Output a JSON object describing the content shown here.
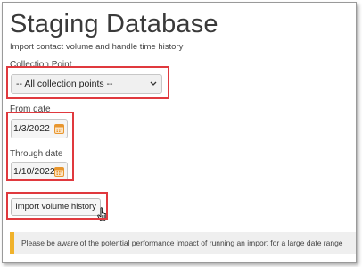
{
  "header": {
    "title": "Staging Database",
    "subtitle": "Import contact volume and handle time history"
  },
  "form": {
    "collection_point_label": "Collection Point",
    "collection_point_value": "-- All collection points --",
    "from_date_label": "From date",
    "from_date_value": "1/3/2022",
    "through_date_label": "Through date",
    "through_date_value": "1/10/2022",
    "import_button_label": "Import volume history"
  },
  "notice": {
    "text": "Please be aware of the potential performance impact of running an import for a large date range"
  },
  "colors": {
    "highlight": "#e0393e",
    "warning_accent": "#f0b22b",
    "calendar_icon": "#e8962e"
  }
}
